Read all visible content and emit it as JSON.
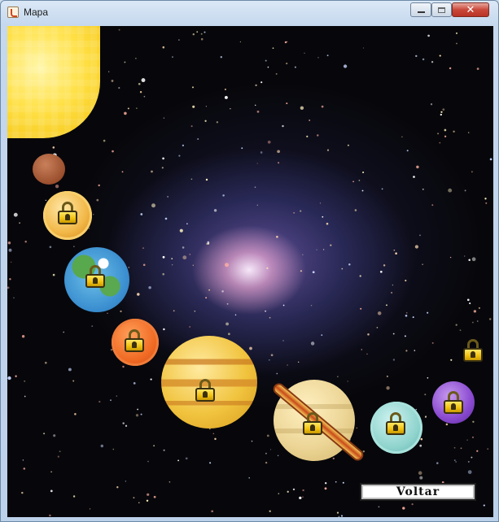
{
  "window": {
    "title": "Mapa",
    "controls": [
      "minimize",
      "maximize",
      "close"
    ]
  },
  "map": {
    "background": "galaxy-starfield",
    "bodies": [
      {
        "id": "sun",
        "icon": "sun-icon",
        "locked": false
      },
      {
        "id": "mercury",
        "icon": "planet-icon",
        "locked": false
      },
      {
        "id": "venus",
        "icon": "planet-icon",
        "locked": true
      },
      {
        "id": "earth",
        "icon": "planet-icon",
        "locked": true
      },
      {
        "id": "mars",
        "icon": "planet-icon",
        "locked": true
      },
      {
        "id": "jupiter",
        "icon": "planet-icon",
        "locked": true
      },
      {
        "id": "saturn",
        "icon": "planet-icon",
        "locked": true
      },
      {
        "id": "uranus",
        "icon": "planet-icon",
        "locked": true
      },
      {
        "id": "neptune",
        "icon": "planet-icon",
        "locked": true
      },
      {
        "id": "pluto",
        "icon": "lock-icon",
        "locked": true
      }
    ]
  },
  "buttons": {
    "voltar": "Voltar"
  },
  "colors": {
    "space": "#07070b",
    "lock_gold": "#f2c10e",
    "close_red": "#c9483a"
  }
}
